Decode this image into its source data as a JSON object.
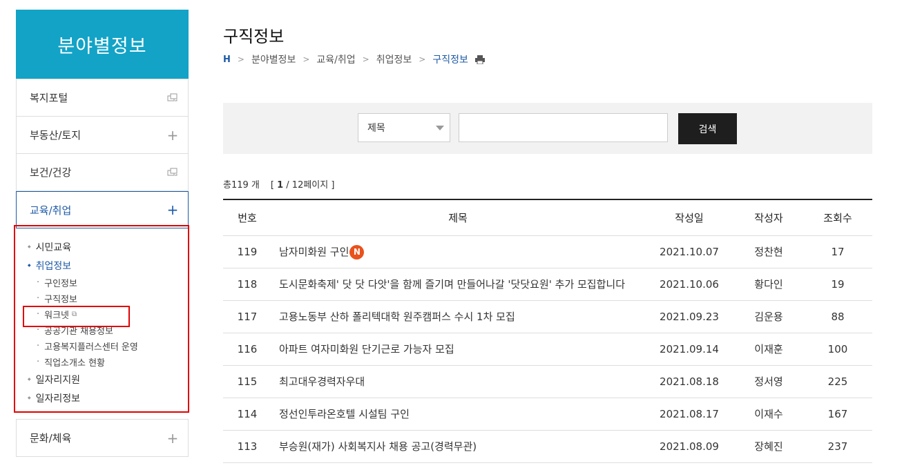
{
  "sidebar": {
    "title": "분야별정보",
    "items": [
      {
        "label": "복지포털",
        "icon": "external-link-icon"
      },
      {
        "label": "부동산/토지",
        "icon": "plus-icon"
      },
      {
        "label": "보건/건강",
        "icon": "external-link-icon"
      },
      {
        "label": "교육/취업",
        "icon": "plus-icon",
        "active": true
      }
    ],
    "submenu": {
      "level1": [
        "시민교육",
        "취업정보",
        "일자리지원",
        "일자리정보"
      ],
      "level2": [
        "구인정보",
        "구직정보",
        "워크넷",
        "공공기관 채용정보",
        "고용복지플러스센터 운영",
        "직업소개소 현황"
      ]
    },
    "bottom_items": [
      {
        "label": "문화/체육",
        "icon": "plus-icon"
      }
    ]
  },
  "page": {
    "title": "구직정보",
    "breadcrumb": [
      "H",
      "분야별정보",
      "교육/취업",
      "취업정보",
      "구직정보"
    ]
  },
  "search": {
    "select_value": "제목",
    "input_value": "",
    "button_label": "검색"
  },
  "summary": {
    "total_prefix": "총119 개",
    "page_open": "[",
    "page_current": "1",
    "page_rest": "/ 12페이지 ]"
  },
  "table": {
    "headers": [
      "번호",
      "제목",
      "작성일",
      "작성자",
      "조회수"
    ],
    "new_badge": "N",
    "rows": [
      {
        "no": "119",
        "title": "남자미화원 구인",
        "date": "2021.10.07",
        "author": "정찬현",
        "views": "17",
        "is_new": true
      },
      {
        "no": "118",
        "title": "도시문화축제' 닷 닷 다앗'을 함께 즐기며 만들어나갈 '닷닷요원' 추가 모집합니다",
        "date": "2021.10.06",
        "author": "황다인",
        "views": "19"
      },
      {
        "no": "117",
        "title": "고용노동부 산하 폴리텍대학 원주캠퍼스 수시 1차 모집",
        "date": "2021.09.23",
        "author": "김운용",
        "views": "88"
      },
      {
        "no": "116",
        "title": "아파트 여자미화원 단기근로 가능자 모집",
        "date": "2021.09.14",
        "author": "이재훈",
        "views": "100"
      },
      {
        "no": "115",
        "title": "최고대우경력자우대",
        "date": "2021.08.18",
        "author": "정서영",
        "views": "225"
      },
      {
        "no": "114",
        "title": "정선인투라온호텔 시설팀 구인",
        "date": "2021.08.17",
        "author": "이재수",
        "views": "167"
      },
      {
        "no": "113",
        "title": "부승원(재가) 사회복지사 채용 공고(경력무관)",
        "date": "2021.08.09",
        "author": "장혜진",
        "views": "237"
      }
    ]
  },
  "colors": {
    "brand": "#12a3c7",
    "active": "#1d5aa6",
    "highlight_box": "#e00000",
    "new_badge": "#e9521c"
  }
}
